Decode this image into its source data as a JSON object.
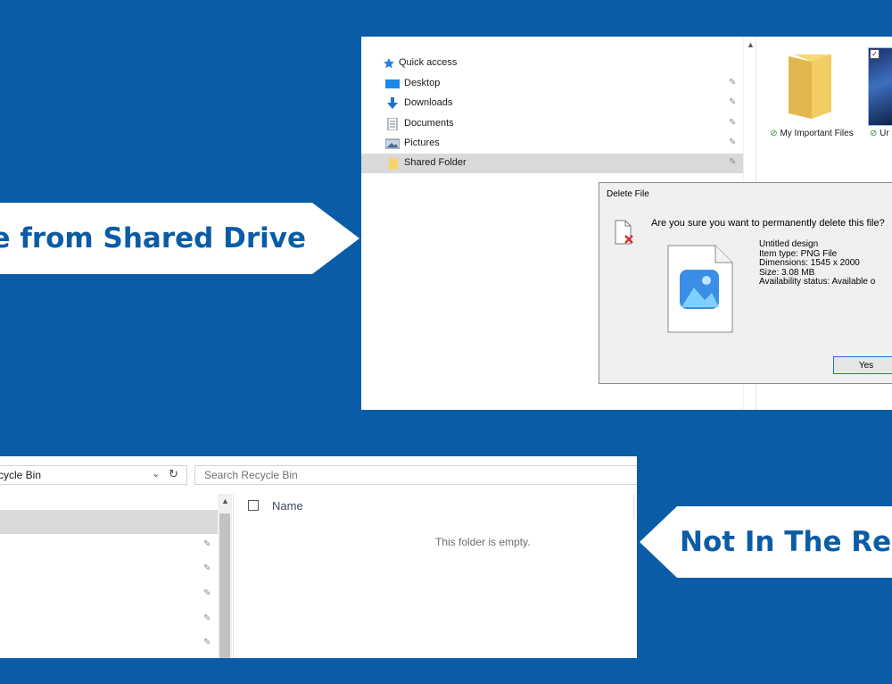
{
  "callouts": {
    "top": "le from Shared Drive",
    "bottom": "Not In The Re"
  },
  "top_window": {
    "nav_items": [
      {
        "label": "Quick access",
        "icon": "star-icon"
      },
      {
        "label": "Desktop",
        "icon": "desktop-icon"
      },
      {
        "label": "Downloads",
        "icon": "download-arrow-icon"
      },
      {
        "label": "Documents",
        "icon": "document-icon"
      },
      {
        "label": "Pictures",
        "icon": "pictures-icon"
      },
      {
        "label": "Shared Folder",
        "icon": "folder-icon",
        "selected": true
      }
    ],
    "files": [
      {
        "name": "My Important Files",
        "status": "available",
        "icon": "folder-icon"
      },
      {
        "name": "Ur",
        "status": "available",
        "icon": "image-thumbnail"
      }
    ]
  },
  "dialog": {
    "title": "Delete File",
    "question": "Are you sure you want to permanently delete this file?",
    "file_name": "Untitled design",
    "item_type": "Item type: PNG File",
    "dimensions": "Dimensions: 1545 x 2000",
    "size": "Size: 3.08 MB",
    "availability": "Availability status: Available o",
    "yes_label": "Yes"
  },
  "bottom_window": {
    "address": "cycle Bin",
    "search_placeholder": "Search Recycle Bin",
    "column_name": "Name",
    "empty_message": "This folder is empty."
  },
  "colors": {
    "background": "#0a5ca6",
    "callout_text": "#0a5ca6",
    "selection": "#d9d9d9"
  }
}
